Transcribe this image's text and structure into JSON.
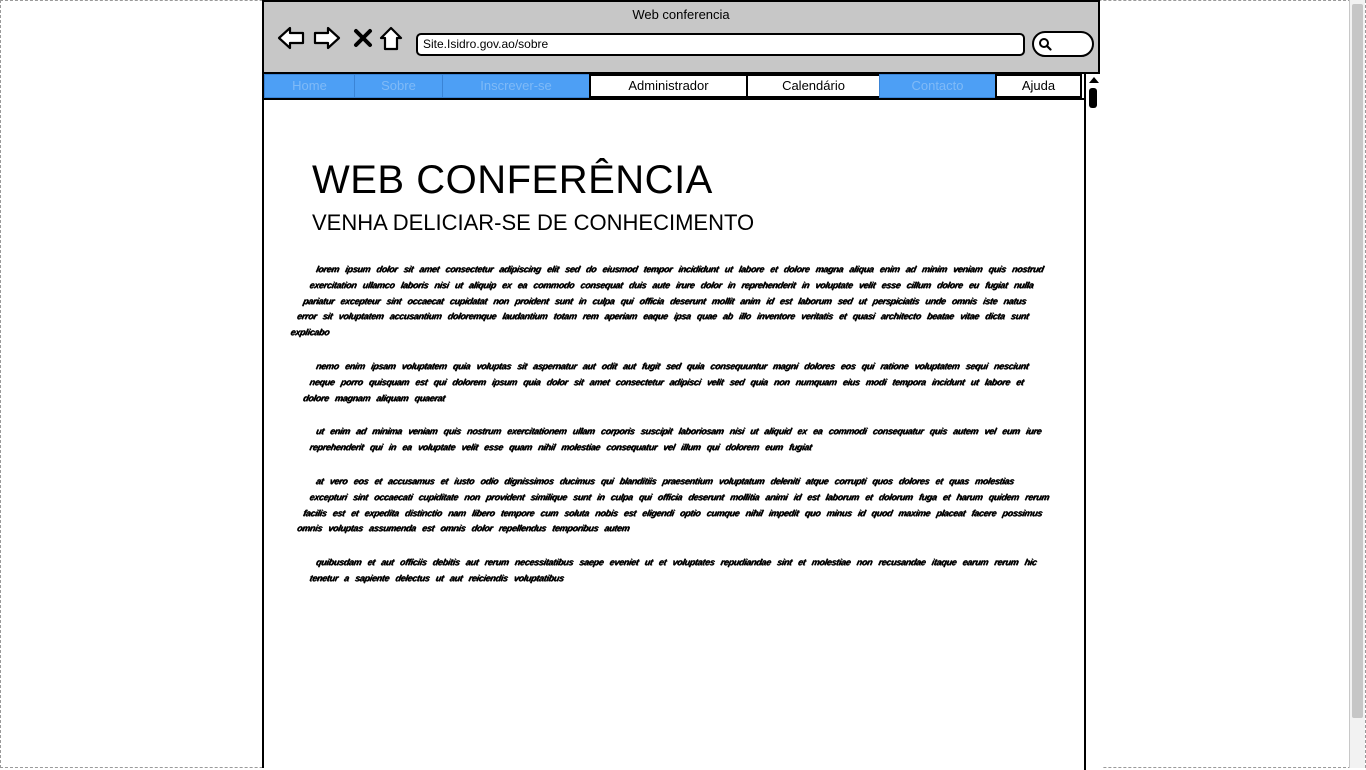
{
  "window": {
    "title": "Web conferencia"
  },
  "toolbar": {
    "back_icon": "arrow-left-icon",
    "forward_icon": "arrow-right-icon",
    "stop_icon": "close-x-icon",
    "home_icon": "home-icon",
    "address": "Site.Isidro.gov.ao/sobre",
    "search_icon": "search-icon"
  },
  "nav": {
    "tabs": [
      {
        "label": "Home",
        "style": "blue"
      },
      {
        "label": "Sobre",
        "style": "blue"
      },
      {
        "label": "Inscrever-se",
        "style": "blue"
      },
      {
        "label": "Administrador",
        "style": "white"
      },
      {
        "label": "Calendário",
        "style": "white"
      },
      {
        "label": "Contacto",
        "style": "blue"
      },
      {
        "label": "Ajuda",
        "style": "white"
      }
    ]
  },
  "main": {
    "title": "WEB CONFERÊNCIA",
    "subtitle": "VENHA DELICIAR-SE DE CONHECIMENTO",
    "paragraphs": [
      "lorem ipsum dolor sit amet consectetur adipiscing elit sed do eiusmod tempor incididunt ut labore et dolore magna aliqua enim ad minim veniam quis nostrud exercitation ullamco laboris nisi ut aliquip ex ea commodo consequat duis aute irure dolor in reprehenderit in voluptate velit esse cillum dolore eu fugiat nulla pariatur excepteur sint occaecat cupidatat non proident sunt in culpa qui officia deserunt mollit anim id est laborum sed ut perspiciatis unde omnis iste natus error sit voluptatem accusantium doloremque laudantium totam rem aperiam eaque ipsa quae ab illo inventore veritatis et quasi architecto beatae vitae dicta sunt explicabo",
      "nemo enim ipsam voluptatem quia voluptas sit aspernatur aut odit aut fugit sed quia consequuntur magni dolores eos qui ratione voluptatem sequi nesciunt neque porro quisquam est qui dolorem ipsum quia dolor sit amet consectetur adipisci velit sed quia non numquam eius modi tempora incidunt ut labore et dolore magnam aliquam quaerat",
      "ut enim ad minima veniam quis nostrum exercitationem ullam corporis suscipit laboriosam nisi ut aliquid ex ea commodi consequatur quis autem vel eum iure reprehenderit qui in ea voluptate velit esse quam nihil molestiae consequatur vel illum qui dolorem eum fugiat",
      "at vero eos et accusamus et iusto odio dignissimos ducimus qui blanditiis praesentium voluptatum deleniti atque corrupti quos dolores et quas molestias excepturi sint occaecati cupiditate non provident similique sunt in culpa qui officia deserunt mollitia animi id est laborum et dolorum fuga et harum quidem rerum facilis est et expedita distinctio nam libero tempore cum soluta nobis est eligendi optio cumque nihil impedit quo minus id quod maxime placeat facere possimus omnis voluptas assumenda est omnis dolor repellendus temporibus autem",
      "quibusdam et aut officiis debitis aut rerum necessitatibus saepe eveniet ut et voluptates repudiandae sint et molestiae non recusandae itaque earum rerum hic tenetur a sapiente delectus ut aut reiciendis voluptatibus"
    ]
  }
}
